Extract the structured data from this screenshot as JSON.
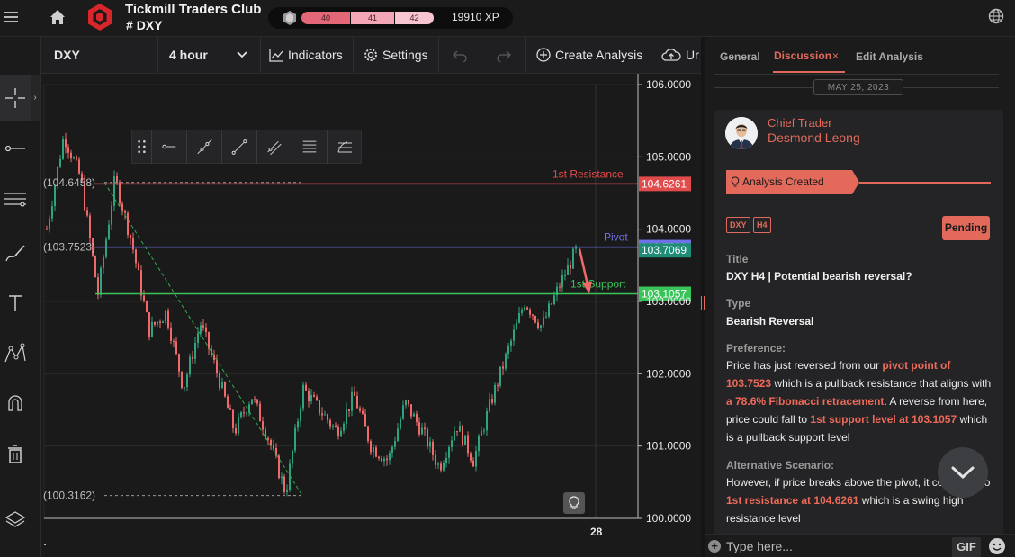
{
  "topbar": {
    "club_name": "Tickmill Traders Club",
    "room_hash": "#",
    "room_name": "DXY",
    "xp_levels": [
      "40",
      "41",
      "42"
    ],
    "xp_total": "19910 XP"
  },
  "chart_toolbar": {
    "symbol": "DXY",
    "interval": "4 hour",
    "indicators_label": "Indicators",
    "settings_label": "Settings",
    "create_analysis_label": "Create Analysis",
    "upload_label": "Ur"
  },
  "chart_data": {
    "type": "candlestick",
    "symbol": "DXY",
    "interval": "4 hour",
    "ylim": [
      100.0,
      106.0
    ],
    "y_ticks": [
      "106.0000",
      "105.0000",
      "104.0000",
      "103.0000",
      "102.0000",
      "101.0000",
      "100.0000"
    ],
    "x_tick_label": "28",
    "levels": [
      {
        "name": "1st Resistance",
        "value": 104.6261,
        "value_label": "104.6261",
        "color": "#e04b4b"
      },
      {
        "name": "Pivot",
        "value": 103.7523,
        "value_label": "103.7523",
        "color": "#6f6fe8"
      },
      {
        "name": "1st Support",
        "value": 103.1057,
        "value_label": "103.1057",
        "color": "#39c45a"
      }
    ],
    "last_price": 103.7069,
    "last_price_label": "103.7069",
    "fib_labels": [
      {
        "text": "(104.6458)",
        "value": 104.6458
      },
      {
        "text": "(103.7523)",
        "value": 103.7523
      },
      {
        "text": "(100.3162)",
        "value": 100.3162
      }
    ],
    "price_path": [
      104.0,
      105.3,
      104.7,
      103.1,
      104.7,
      103.8,
      102.6,
      102.85,
      101.8,
      102.7,
      102.0,
      101.2,
      101.7,
      101.1,
      100.35,
      101.8,
      101.5,
      101.2,
      101.7,
      101.0,
      100.8,
      101.6,
      101.2,
      100.7,
      101.3,
      100.8,
      101.6,
      102.3,
      103.0,
      102.65,
      103.2,
      103.7
    ],
    "colors": {
      "up": "#2fa37d",
      "down": "#ee6a6a",
      "grid": "#2a2a2a",
      "fib": "#2fae4a"
    }
  },
  "panel": {
    "tabs": [
      "General",
      "Discussion",
      "Edit Analysis"
    ],
    "date_label": "MAY 25, 2023",
    "author_role": "Chief Trader",
    "author_name": "Desmond Leong",
    "event_label": "Analysis Created",
    "chips": [
      "DXY",
      "H4"
    ],
    "status": "Pending",
    "title_label": "Title",
    "title_value": "DXY H4 | Potential bearish reversal?",
    "type_label": "Type",
    "type_value": "Bearish Reversal",
    "preference_label": "Preference:",
    "pref_t1": "Price has just reversed from our ",
    "pref_h1": "pivot point of 103.7523",
    "pref_t2": " which is a pullback resistance that aligns with ",
    "pref_h2": "a 78.6% Fibonacci retracement",
    "pref_t3": ". A reverse from here, price could fall to ",
    "pref_h3": "1st support level at 103.1057",
    "pref_t4": " which is a pullback support level",
    "alt_label": "Alternative Scenario:",
    "alt_t1": "However, if price breaks above the pivot, it could rise to ",
    "alt_h1": "1st resistance at 104.6261",
    "alt_t2": " which is a swing high resistance level"
  },
  "input": {
    "placeholder": "Type here...",
    "gif_label": "GIF"
  },
  "colors": {
    "accent": "#e06b5c",
    "background": "#151515"
  }
}
